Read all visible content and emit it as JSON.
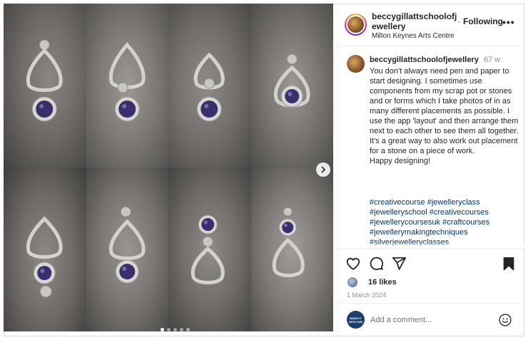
{
  "post": {
    "header": {
      "username": "beccygillattschoolofjewellery",
      "separator": "·",
      "follow_status": "Following",
      "more_label": "•••",
      "location": "Milton Keynes Arts Centre"
    },
    "caption": {
      "username": "beccygillattschoolofjewellery",
      "time": "67 w",
      "text": "You don't always need pen and paper to start designing. I sometimes use components from my scrap pot or stones and or forms which I take photos of in as many different placements as possible. I use the app 'layout' and then arrange them next to each other to see them all together.\nIt's a great way to also work out placement for a stone on a piece of work.\nHappy designing!",
      "hashtags": [
        "#creativecourse #jewelleryclass",
        "#jewelleryschool #creativecourses",
        "#jewellerycoursesuk #craftcourses",
        "#jewellerymakingtechniques",
        "#silverjewelleryclasses"
      ]
    },
    "actions": {
      "icons": [
        "heart-icon",
        "comment-icon",
        "share-icon",
        "bookmark-icon"
      ],
      "likes": "16 likes",
      "date": "1 March 2024"
    },
    "comment": {
      "placeholder": "Add a comment...",
      "avatar_text": [
        "MAKE IT",
        "WITH KIM"
      ]
    },
    "media": {
      "carousel_slides": 5,
      "active_slide": 1
    }
  },
  "colors": {
    "link": "#00376b",
    "text": "#262626",
    "muted": "#8e8e8e",
    "stone": "#3b2f6b"
  }
}
